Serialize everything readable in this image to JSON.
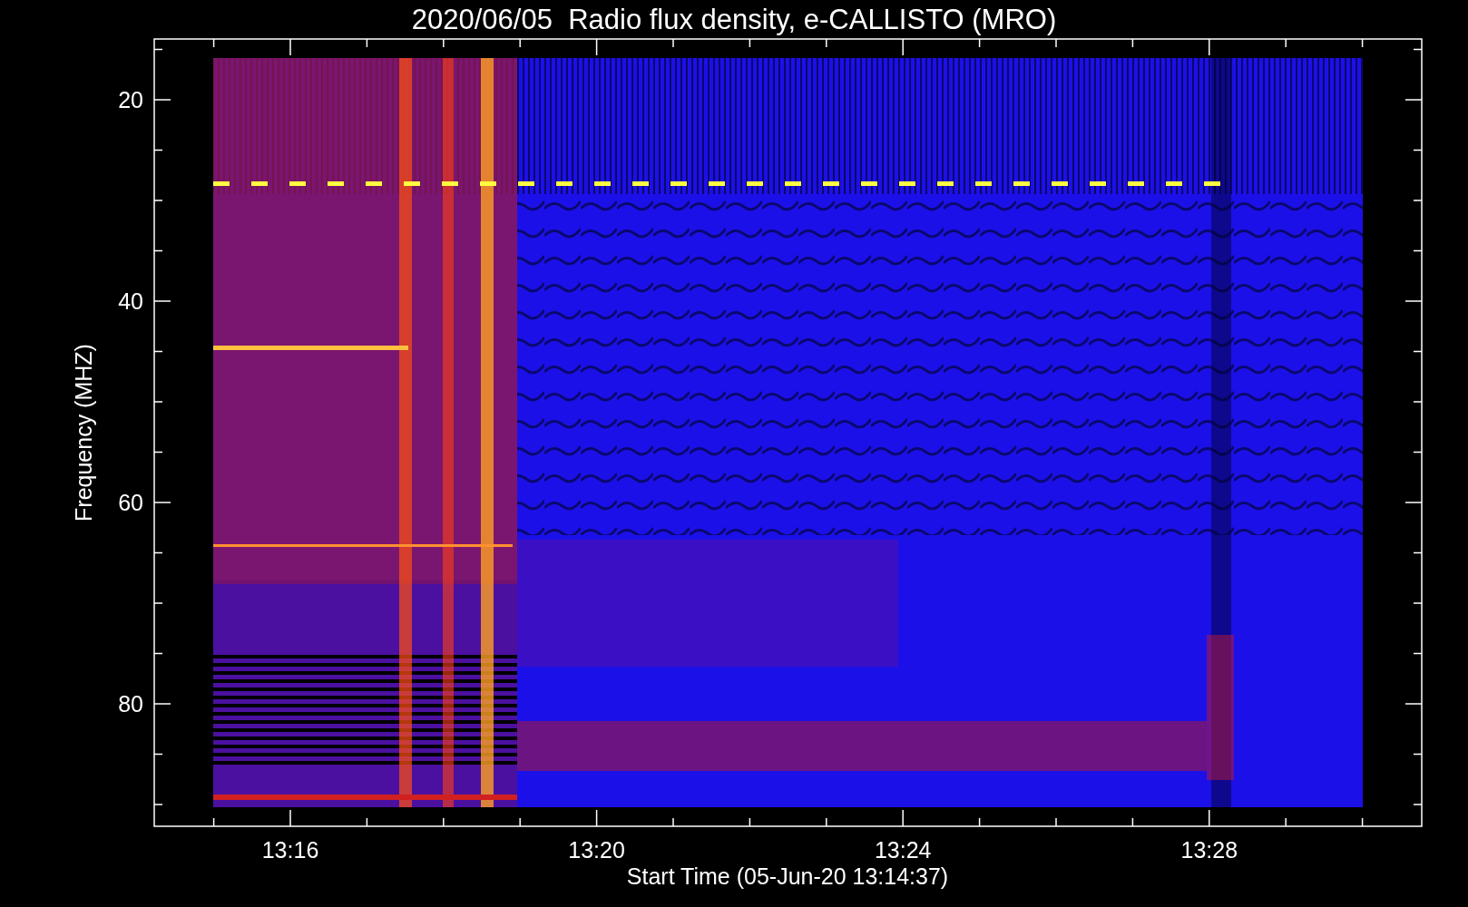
{
  "title": "2020/06/05  Radio flux density, e-CALLISTO (MRO)",
  "y_axis": {
    "label": "Frequency (MHZ)",
    "ticks": [
      "20",
      "40",
      "60",
      "80"
    ]
  },
  "x_axis": {
    "label": "Start Time (05-Jun-20 13:14:37)",
    "ticks": [
      "13:16",
      "13:20",
      "13:24",
      "13:28"
    ]
  }
}
